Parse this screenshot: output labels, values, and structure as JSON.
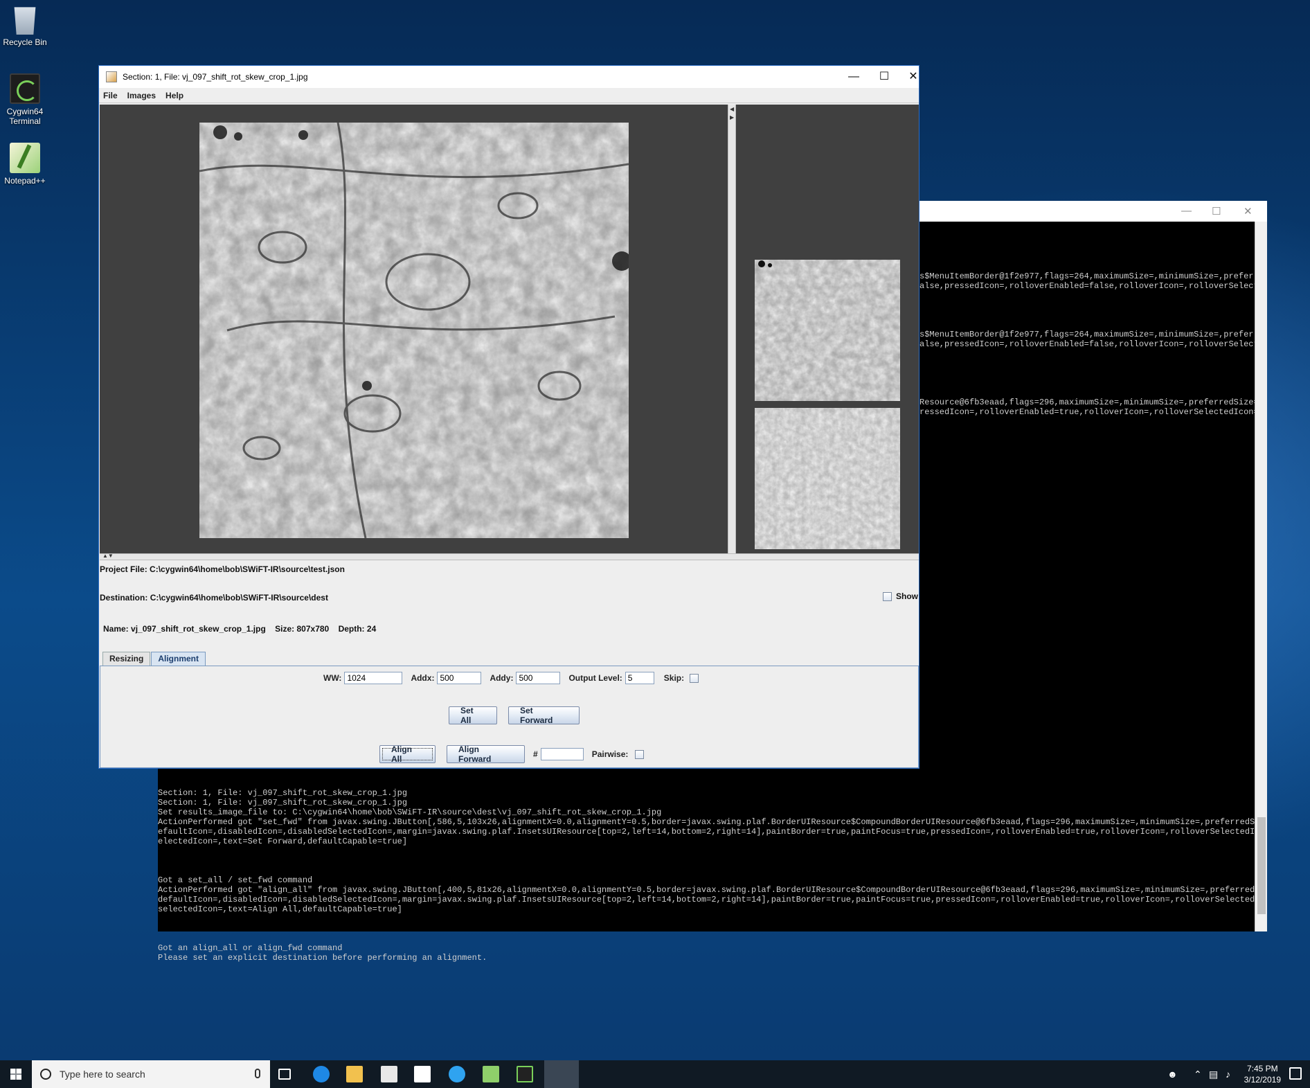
{
  "desktop": {
    "icons": [
      {
        "label": "Recycle Bin"
      },
      {
        "label": "Cygwin64 Terminal"
      },
      {
        "label": "Notepad++"
      }
    ]
  },
  "swift_window": {
    "title": "Section: 1, File: vj_097_shift_rot_skew_crop_1.jpg",
    "menu": [
      "File",
      "Images",
      "Help"
    ],
    "project_file_label": "Project File:",
    "project_file": "C:\\cygwin64\\home\\bob\\SWiFT-IR\\source\\test.json",
    "destination_label": "Destination:",
    "destination": "C:\\cygwin64\\home\\bob\\SWiFT-IR\\source\\dest",
    "show_label": "Show",
    "name_label": "Name:",
    "name": "vj_097_shift_rot_skew_crop_1.jpg",
    "size_label": "Size:",
    "size": "807x780",
    "depth_label": "Depth:",
    "depth": "24",
    "tabs": [
      "Resizing",
      "Alignment"
    ],
    "active_tab": "Alignment",
    "alignment": {
      "ww_label": "WW:",
      "ww_value": "1024",
      "addx_label": "Addx:",
      "addx_value": "500",
      "addy_label": "Addy:",
      "addy_value": "500",
      "output_level_label": "Output Level:",
      "output_level_value": "5",
      "skip_label": "Skip:",
      "set_all": "Set All",
      "set_forward": "Set Forward",
      "align_all": "Align All",
      "align_forward": "Align Forward",
      "hash_label": "#",
      "hash_value": "",
      "pairwise_label": "Pairwise:"
    }
  },
  "console": {
    "top_lines": "s$MenuItemBorder@1f2e977,flags=264,maximumSize=,minimumSize=,preferre\nalse,pressedIcon=,rolloverEnabled=false,rolloverIcon=,rolloverSelecte\n\n\n\n\ns$MenuItemBorder@1f2e977,flags=264,maximumSize=,minimumSize=,preferre\nalse,pressedIcon=,rolloverEnabled=false,rolloverIcon=,rolloverSelecte\n\n\n\n\n\nResource@6fb3eaad,flags=296,maximumSize=,minimumSize=,preferredSize=,\nressedIcon=,rolloverEnabled=true,rolloverIcon=,rolloverSelectedIcon=,",
    "bottom_lines": "Section: 1, File: vj_097_shift_rot_skew_crop_1.jpg\nSection: 1, File: vj_097_shift_rot_skew_crop_1.jpg\nSet results_image_file to: C:\\cygwin64\\home\\bob\\SWiFT-IR\\source\\dest\\vj_097_shift_rot_skew_crop_1.jpg\nActionPerformed got \"set_fwd\" from javax.swing.JButton[,586,5,103x26,alignmentX=0.0,alignmentY=0.5,border=javax.swing.plaf.BorderUIResource$CompoundBorderUIResource@6fb3eaad,flags=296,maximumSize=,minimumSize=,preferredSize=,d\nefaultIcon=,disabledIcon=,disabledSelectedIcon=,margin=javax.swing.plaf.InsetsUIResource[top=2,left=14,bottom=2,right=14],paintBorder=true,paintFocus=true,pressedIcon=,rolloverEnabled=true,rolloverIcon=,rolloverSelectedIcon=,s\nelectedIcon=,text=Set Forward,defaultCapable=true]\n\n\n\nGot a set_all / set_fwd command\nActionPerformed got \"align_all\" from javax.swing.JButton[,400,5,81x26,alignmentX=0.0,alignmentY=0.5,border=javax.swing.plaf.BorderUIResource$CompoundBorderUIResource@6fb3eaad,flags=296,maximumSize=,minimumSize=,preferredSize=,\ndefaultIcon=,disabledIcon=,disabledSelectedIcon=,margin=javax.swing.plaf.InsetsUIResource[top=2,left=14,bottom=2,right=14],paintBorder=true,paintFocus=true,pressedIcon=,rolloverEnabled=true,rolloverIcon=,rolloverSelectedIcon=,\nselectedIcon=,text=Align All,defaultCapable=true]\n\n\n\nGot an align_all or align_fwd command\nPlease set an explicit destination before performing an alignment."
  },
  "taskbar": {
    "search_placeholder": "Type here to search",
    "time": "7:45 PM",
    "date": "3/12/2019"
  },
  "icons": {
    "window_minimize": "minimize-icon",
    "window_maximize": "maximize-icon",
    "window_close": "close-icon"
  },
  "colors": {
    "viewer_bg": "#404040",
    "console_bg": "#000000",
    "window_border": "#2b6cc4",
    "taskbar_bg": "#101a24"
  }
}
